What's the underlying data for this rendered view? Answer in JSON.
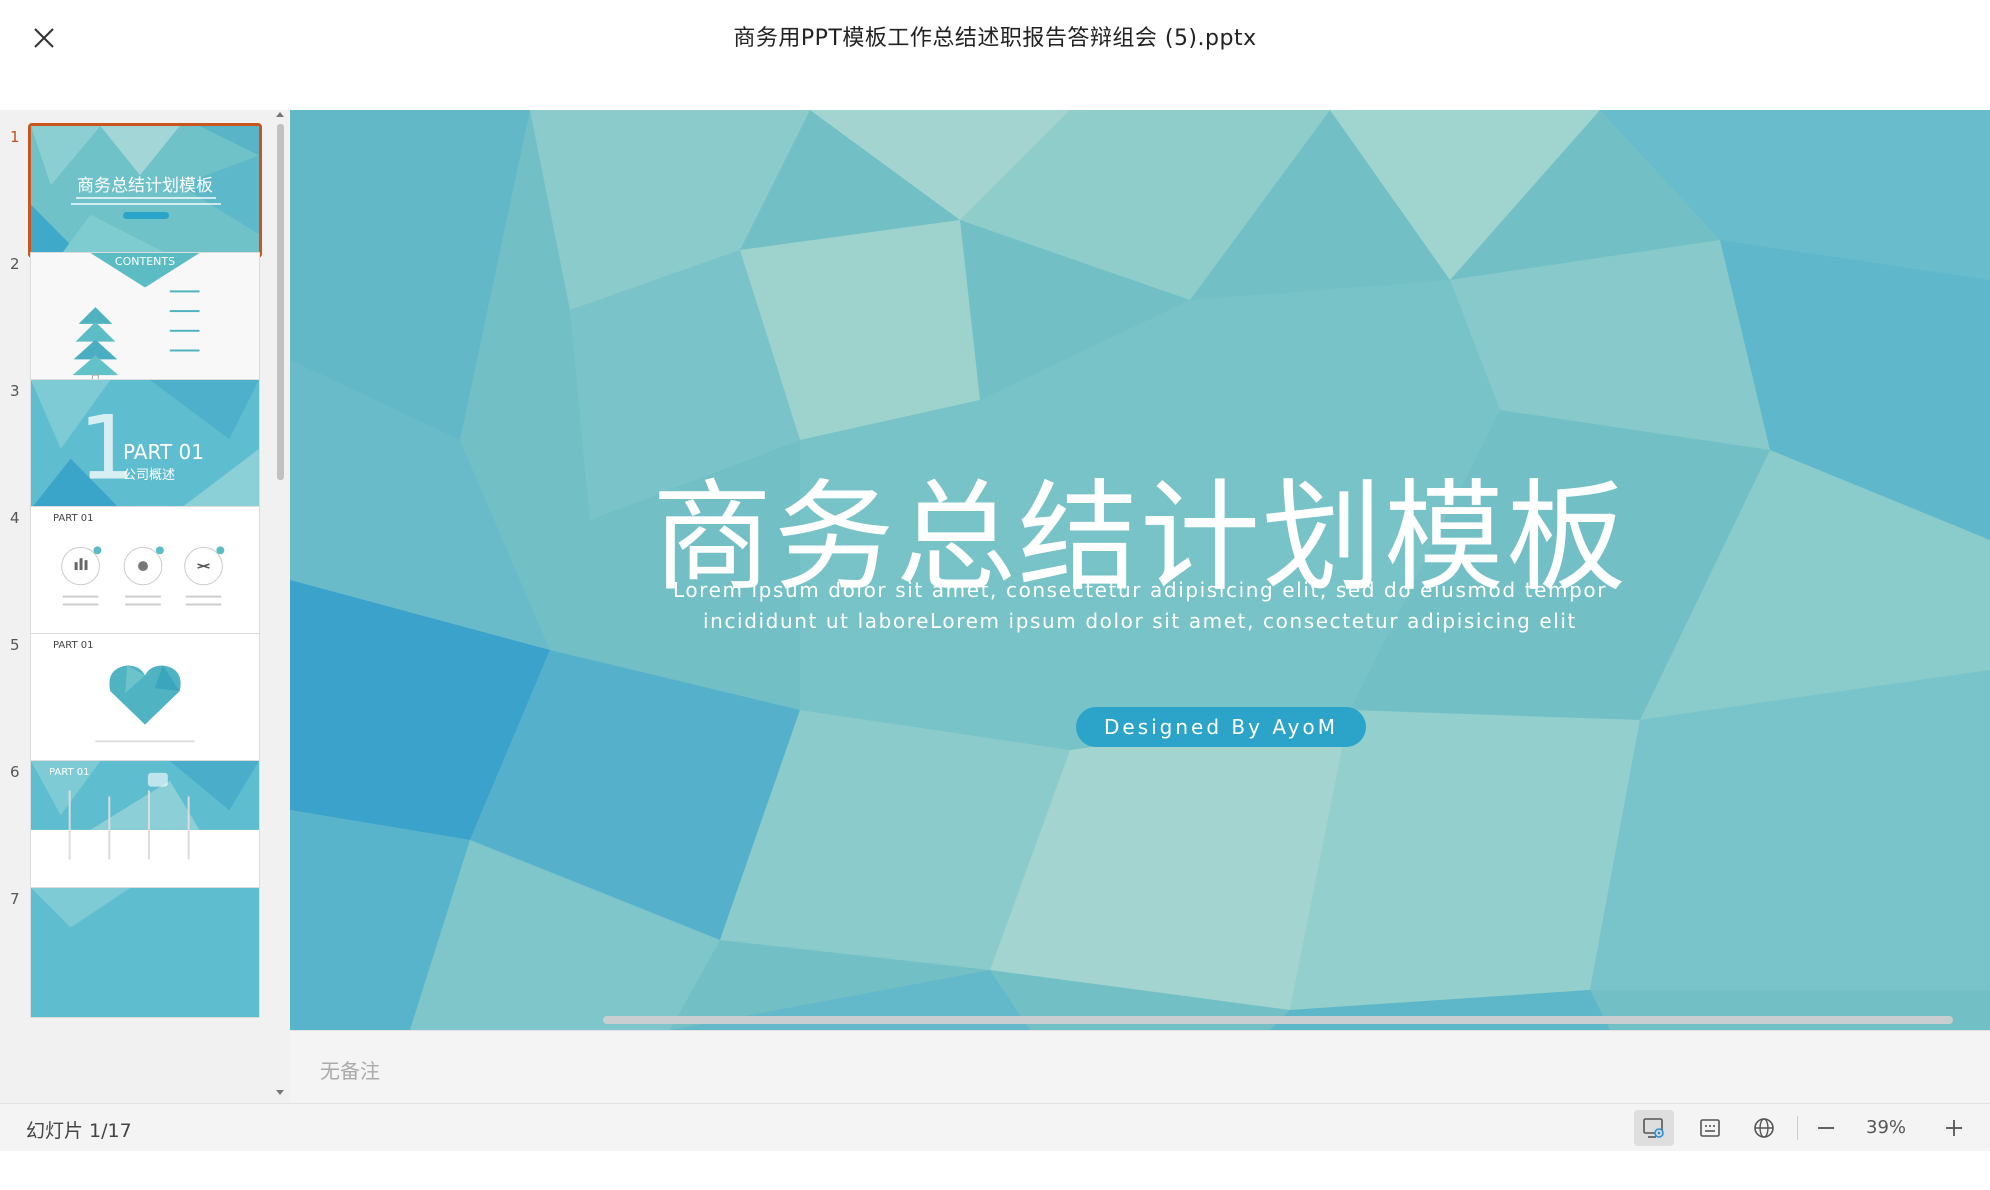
{
  "window": {
    "title": "商务用PPT模板工作总结述职报告答辩组会 (5).pptx"
  },
  "slide": {
    "title": "商务总结计划模板",
    "subtitle_line1": "Lorem ipsum dolor sit amet, consectetur adipisicing elit, sed do eiusmod tempor",
    "subtitle_line2": "incididunt ut laboreLorem ipsum dolor sit amet, consectetur adipisicing elit",
    "designer": "Designed By AyoM"
  },
  "thumbnails": [
    {
      "number": "1",
      "label": "商务总结计划模板",
      "active": true
    },
    {
      "number": "2",
      "label": "CONTENTS"
    },
    {
      "number": "3",
      "label": "PART 01",
      "sublabel": "公司概述"
    },
    {
      "number": "4",
      "label": "PART 01"
    },
    {
      "number": "5",
      "label": "PART 01"
    },
    {
      "number": "6",
      "label": "PART 01"
    },
    {
      "number": "7"
    }
  ],
  "notes": {
    "placeholder": "无备注"
  },
  "status": {
    "slide_counter": "幻灯片 1/17",
    "zoom": "39%"
  },
  "colors": {
    "accent": "#c9561d",
    "slide_teal": "#6fc0c6",
    "pill": "#2ca3c8"
  }
}
